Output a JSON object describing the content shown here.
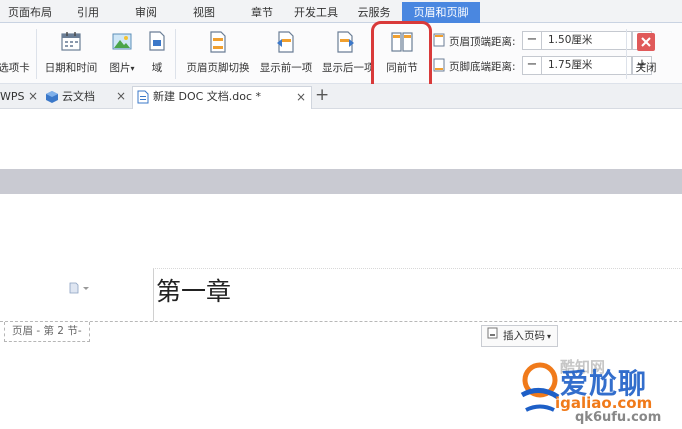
{
  "menu": {
    "tabs": [
      {
        "label": "页面布局"
      },
      {
        "label": "引用"
      },
      {
        "label": "审阅"
      },
      {
        "label": "视图"
      },
      {
        "label": "章节"
      },
      {
        "label": "开发工具"
      },
      {
        "label": "云服务"
      },
      {
        "label": "页眉和页脚"
      }
    ],
    "active_tab": "页眉和页脚"
  },
  "ribbon": {
    "tab_options_label": "选项卡",
    "date_time_label": "日期和时间",
    "picture_label": "图片",
    "field_label": "域",
    "switch_header_footer_label": "页眉页脚切换",
    "show_prev_label": "显示前一项",
    "show_next_label": "显示后一项",
    "same_as_prev_label": "同前节",
    "header_top_distance": {
      "label": "页眉顶端距离:",
      "value": "1.50厘米"
    },
    "footer_bottom_distance": {
      "label": "页脚底端距离:",
      "value": "1.75厘米"
    },
    "close_label": "关闭",
    "minus": "−",
    "plus": "+",
    "dropdown_caret": "▾"
  },
  "doc_tabs": {
    "items": [
      {
        "label": "WPS"
      },
      {
        "label": "云文档"
      },
      {
        "label": "新建 DOC 文档.doc *"
      }
    ],
    "close_glyph": "×",
    "add_glyph": "+"
  },
  "document": {
    "heading": "第一章",
    "header_tag": "页眉 - 第 2 节-",
    "insert_page_number_label": "插入页码",
    "insert_caret": "▾"
  },
  "watermark": {
    "brand": "爱尬聊",
    "url": "igaliao.com",
    "url2": "qk6ufu.com",
    "sub": "酷知网"
  },
  "colors": {
    "accent": "#4a87e0",
    "highlight": "#d93a3a",
    "close_button": "#e05a5a"
  }
}
